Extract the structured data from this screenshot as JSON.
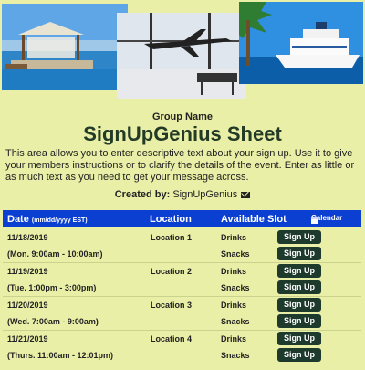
{
  "header": {
    "group_name": "Group Name",
    "title": "SignUpGenius Sheet",
    "description": "This area allows you to enter descriptive text about your sign up. Use it to give your members instructions or to clarify the details of the event. Enter as little or as much text as you need to get your message across.",
    "created_by_label": "Created by:",
    "created_by_name": "SignUpGenius"
  },
  "table": {
    "headers": {
      "date": "Date",
      "date_format": "(mm/dd/yyyy EST)",
      "location": "Location",
      "slot": "Available Slot",
      "calendar": "Calendar"
    },
    "button_label": "Sign Up",
    "rows": [
      {
        "date": "11/18/2019",
        "time": "(Mon. 9:00am - 10:00am)",
        "location": "Location 1",
        "items": [
          "Drinks",
          "Snacks"
        ]
      },
      {
        "date": "11/19/2019",
        "time": "(Tue. 1:00pm - 3:00pm)",
        "location": "Location 2",
        "items": [
          "Drinks",
          "Snacks"
        ]
      },
      {
        "date": "11/20/2019",
        "time": "(Wed. 7:00am - 9:00am)",
        "location": "Location 3",
        "items": [
          "Drinks",
          "Snacks"
        ]
      },
      {
        "date": "11/21/2019",
        "time": "(Thurs. 11:00am - 12:01pm)",
        "location": "Location 4",
        "items": [
          "Drinks",
          "Snacks"
        ]
      }
    ]
  },
  "colors": {
    "background": "#e9efa6",
    "header_bar": "#0b3fd1",
    "button": "#1e3a2c",
    "title": "#223a26"
  },
  "icons": {
    "created_by": "mail-icon",
    "calendar": "calendar-icon"
  }
}
